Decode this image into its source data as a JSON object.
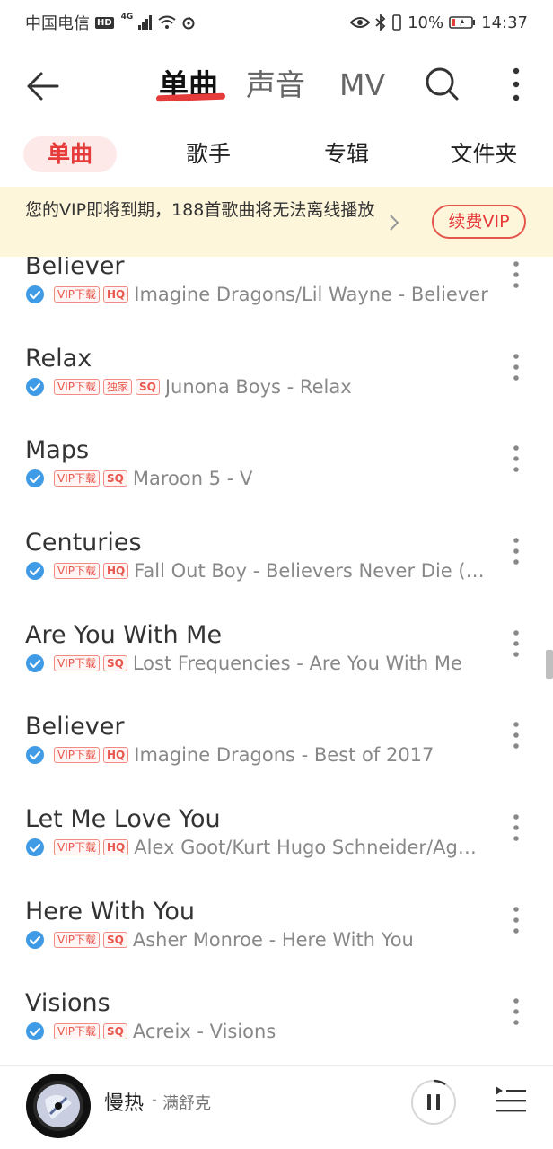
{
  "status_bar": {
    "carrier": "中国电信",
    "hd": "HD",
    "network": "4G",
    "battery": "10%",
    "time": "14:37"
  },
  "top_nav": {
    "tabs": [
      {
        "label": "单曲"
      },
      {
        "label": "声音"
      },
      {
        "label": "MV"
      }
    ]
  },
  "sub_tabs": [
    {
      "label": "单曲"
    },
    {
      "label": "歌手"
    },
    {
      "label": "专辑"
    },
    {
      "label": "文件夹"
    }
  ],
  "vip_banner": {
    "message": "您的VIP即将到期，188首歌曲将无法离线播放",
    "button": "续费VIP"
  },
  "tags": {
    "vip_download": "VIP下载",
    "exclusive": "独家"
  },
  "songs": [
    {
      "title": "Believer",
      "quality": "HQ",
      "artist": "Imagine Dragons/Lil Wayne - Believer"
    },
    {
      "title": "Relax",
      "quality": "SQ",
      "artist": "Junona Boys - Relax"
    },
    {
      "title": "Maps",
      "quality": "SQ",
      "artist": "Maroon 5 - V"
    },
    {
      "title": "Centuries",
      "quality": "HQ",
      "artist": "Fall Out Boy - Believers Never Die (…"
    },
    {
      "title": "Are You With Me",
      "quality": "SQ",
      "artist": "Lost Frequencies - Are You With Me"
    },
    {
      "title": "Believer",
      "quality": "HQ",
      "artist": "Imagine Dragons - Best of 2017"
    },
    {
      "title": "Let Me Love You",
      "quality": "HQ",
      "artist": "Alex Goot/Kurt Hugo Schneider/Ag…"
    },
    {
      "title": "Here With You",
      "quality": "SQ",
      "artist": "Asher Monroe - Here With You"
    },
    {
      "title": "Visions",
      "quality": "SQ",
      "artist": "Acreix - Visions"
    }
  ],
  "player": {
    "song": "慢热",
    "separator": "-",
    "artist": "满舒克"
  },
  "colors": {
    "accent": "#e53b3b",
    "banner_bg": "#fdf6db",
    "check_blue": "#3f9be6"
  }
}
